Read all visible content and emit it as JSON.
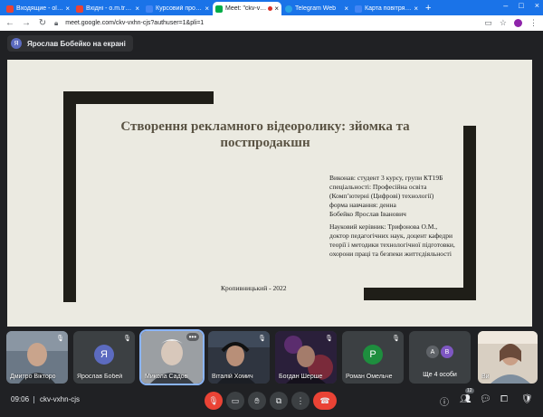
{
  "browser": {
    "tabs": [
      {
        "label": "Входящие - olmar",
        "favicon_color": "#ea4335",
        "active": false
      },
      {
        "label": "Вхідні - o.m.tryfon",
        "favicon_color": "#ea4335",
        "active": false
      },
      {
        "label": "Курсовий проект",
        "favicon_color": "#4285f4",
        "active": false
      },
      {
        "label": "Meet: \"ckv-vxh",
        "favicon_color": "#00ac47",
        "active": true
      },
      {
        "label": "Telegram Web",
        "favicon_color": "#2aa3e4",
        "active": false
      },
      {
        "label": "Карта повітряних",
        "favicon_color": "#4285f4",
        "active": false
      }
    ],
    "url": "meet.google.com/ckv-vxhn-cjs?authuser=1&pli=1"
  },
  "presenter": {
    "avatar_letter": "Я",
    "label": "Ярослав Бобейко на екрані"
  },
  "slide": {
    "title": "Створення рекламного відеоролику: зйомка та постпродакшн",
    "author_lines": [
      "Виконав: студент 3 курсу, групи КТ19Б",
      "спеціальності: Професійна освіта",
      "(Комп’ютерні (Цифрові) технології)",
      "форма навчання: денна",
      "Бобейко Ярослав Іванович"
    ],
    "supervisor_lines": [
      "Науковий керівник: Трифонова О.М.,",
      "доктор педагогічних наук, доцент кафедри",
      "теорії і методики технологічної підготовки,",
      "охорони праці та безпеки життєдіяльності"
    ],
    "city_year": "Кропивницький - 2022"
  },
  "participants": [
    {
      "name": "Дмитро Вікторо",
      "kind": "photo",
      "photo_color": "#6b7886"
    },
    {
      "name": "Ярослав Бобей",
      "kind": "avatar",
      "letter": "Я",
      "color": "#5c6bc0"
    },
    {
      "name": "Микола Садов",
      "kind": "photo",
      "photo_color": "#9b9fa3",
      "selected": true
    },
    {
      "name": "Віталій Хомич",
      "kind": "photo",
      "photo_color": "#2f3540"
    },
    {
      "name": "Богдан Шерше",
      "kind": "photo",
      "photo_color": "#2a1f3a"
    },
    {
      "name": "Роман Омельче",
      "kind": "avatar",
      "letter": "Р",
      "color": "#1e8e3e"
    },
    {
      "name": "Ще 4 особи",
      "kind": "more",
      "letters": [
        "А",
        "В"
      ]
    },
    {
      "name": "Ви",
      "kind": "photo",
      "photo_color": "#d8cfc2"
    }
  ],
  "controls": {
    "time": "09:06",
    "meeting_code": "ckv-vxhn-cjs",
    "participants_count": "12"
  },
  "colors": {
    "brand_blue": "#1a73e8",
    "slide_background": "#ebeae1",
    "slide_bar": "#1f1e18",
    "title_color": "#5a5343",
    "end_call": "#ea4335"
  }
}
